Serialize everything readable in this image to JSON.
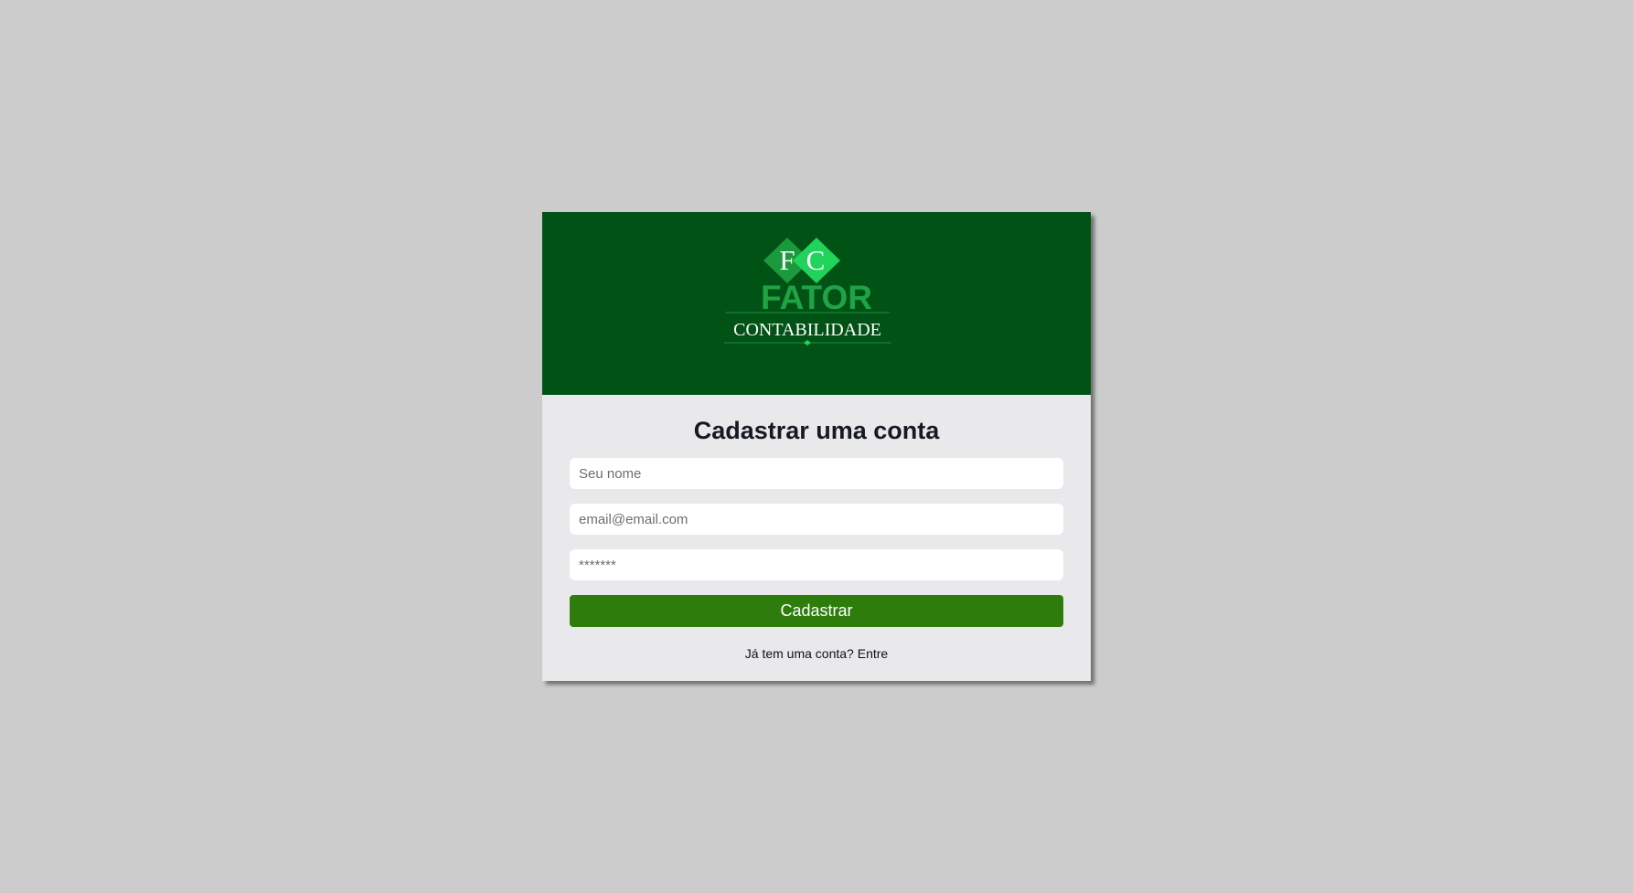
{
  "brand": {
    "monogram_left": "F",
    "monogram_right": "C",
    "name": "FATOR",
    "tagline": "CONTABILIDADE",
    "colors": {
      "header_bg": "#005215",
      "diamond_dark": "#1a9a3c",
      "diamond_light": "#20d35a",
      "wordmark": "#1fa345"
    }
  },
  "form": {
    "title": "Cadastrar uma conta",
    "name_placeholder": "Seu nome",
    "email_placeholder": "email@email.com",
    "password_placeholder": "*******",
    "submit_label": "Cadastrar",
    "submit_color": "#2e7d0c",
    "signin_prompt": "Já tem uma conta?",
    "signin_link": "Entre"
  }
}
